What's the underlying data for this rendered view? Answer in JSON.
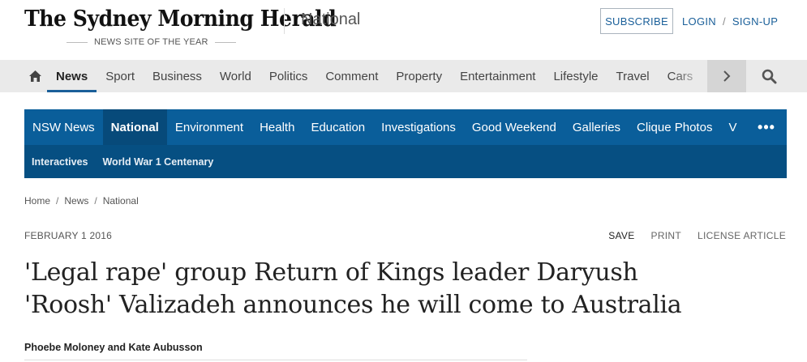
{
  "masthead": {
    "logo_text": "The Sydney Morning Herald",
    "tagline": "NEWS SITE OF THE YEAR",
    "section": "National",
    "subscribe_label": "SUBSCRIBE",
    "login_label": "LOGIN",
    "login_sep": "/",
    "signup_label": "SIGN-UP"
  },
  "primary_nav": {
    "items": [
      "News",
      "Sport",
      "Business",
      "World",
      "Politics",
      "Comment",
      "Property",
      "Entertainment",
      "Lifestyle",
      "Travel",
      "Cars"
    ],
    "active": "News"
  },
  "secondary_nav": {
    "items": [
      "NSW News",
      "National",
      "Environment",
      "Health",
      "Education",
      "Investigations",
      "Good Weekend",
      "Galleries",
      "Clique Photos",
      "V"
    ],
    "active": "National",
    "more_label": "•••",
    "sub_items": [
      "Interactives",
      "World War 1 Centenary"
    ]
  },
  "breadcrumb": {
    "items": [
      "Home",
      "News",
      "National"
    ],
    "separator": "/"
  },
  "article": {
    "date": "FEBRUARY 1 2016",
    "actions": [
      "SAVE",
      "PRINT",
      "LICENSE ARTICLE"
    ],
    "headline_line1": "'Legal rape' group Return of Kings leader Daryush",
    "headline_line2": "'Roosh' Valizadeh announces he will come to Australia",
    "byline": "Phoebe Moloney and Kate Aubusson"
  },
  "colors": {
    "brand_blue": "#0a5e9a",
    "link_blue": "#1a5f99",
    "nav_grey": "#eaeaea"
  },
  "icons": {
    "home": "home-icon",
    "next": "chevron-right-icon",
    "search": "search-icon",
    "more": "more-dots-icon"
  }
}
